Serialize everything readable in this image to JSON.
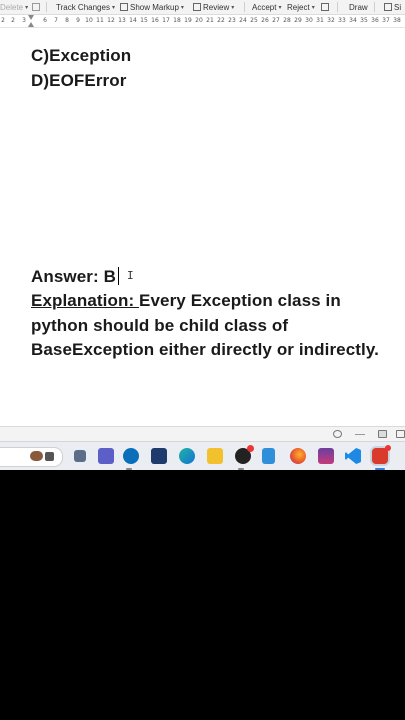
{
  "ribbon": {
    "delete_label": "Delete",
    "track_changes_label": "Track Changes",
    "show_markup_label": "Show Markup",
    "review_label": "Review",
    "accept_label": "Accept",
    "reject_label": "Reject",
    "draw_label": "Draw",
    "simplified_label": "Si"
  },
  "ruler": {
    "left_ticks": [
      "2",
      "1",
      "2",
      "3",
      "4"
    ],
    "ticks": [
      "6",
      "7",
      "8",
      "9",
      "10",
      "11",
      "12",
      "13",
      "14",
      "15",
      "16",
      "17",
      "18",
      "19",
      "20",
      "21",
      "22",
      "23",
      "24",
      "25",
      "26",
      "27",
      "28",
      "29",
      "30",
      "31",
      "32",
      "33",
      "34",
      "35",
      "36",
      "37",
      "38"
    ]
  },
  "document": {
    "option_c": "C)Exception",
    "option_d": "D)EOFError",
    "answer": "Answer: B",
    "explanation_label": "Explanation: ",
    "explanation_line1": "Every Exception class in",
    "explanation_line2": "python should be child class of",
    "explanation_line3": "BaseException either directly or indirectly."
  },
  "taskbar": {
    "apps": [
      "file-manager-icon",
      "teams-icon",
      "dell-icon",
      "store-icon",
      "edge-icon",
      "folder-icon",
      "obs-icon",
      "notepad-icon",
      "firefox-icon",
      "winrar-icon",
      "vscode-icon",
      "wps-icon"
    ]
  },
  "colors": {
    "ribbon_bg": "#f3f3f3",
    "taskbar_bg": "#eaeef3",
    "text": "#1a1a1a"
  }
}
